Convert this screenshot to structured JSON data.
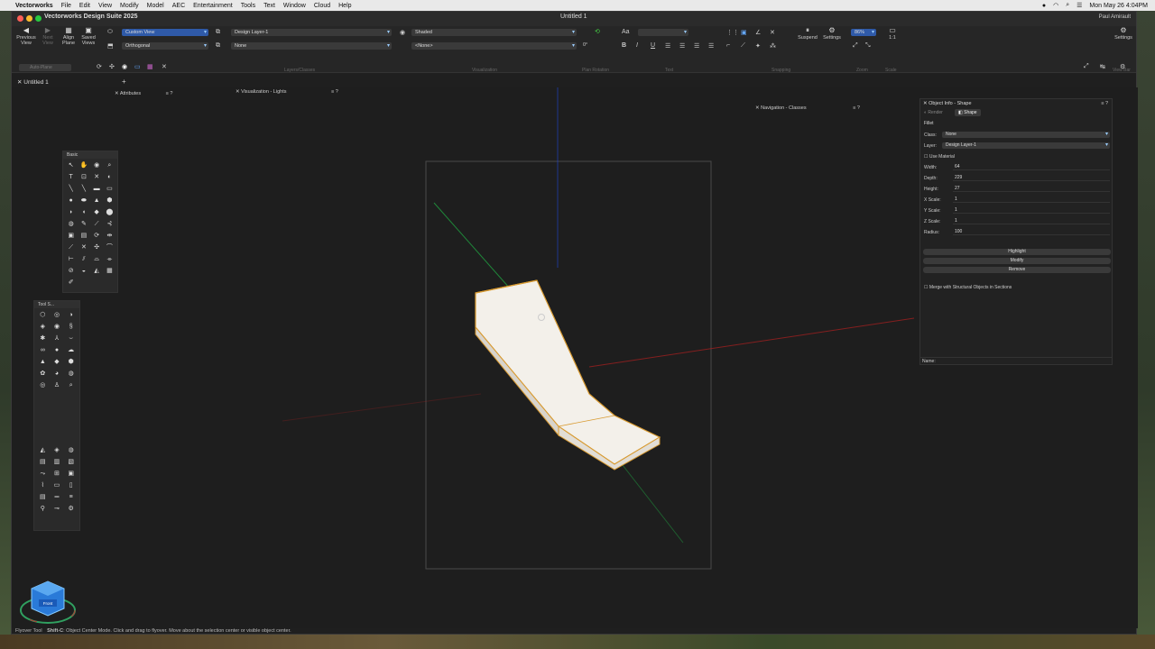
{
  "menubar": {
    "app": "Vectorworks",
    "items": [
      "File",
      "Edit",
      "View",
      "Modify",
      "Model",
      "AEC",
      "Entertainment",
      "Tools",
      "Text",
      "Window",
      "Cloud",
      "Help"
    ],
    "datetime": "Mon May 26 4:04PM"
  },
  "window": {
    "app_title": "Vectorworks Design Suite 2025",
    "doc_title": "Untitled 1",
    "user": "Paul Amirault"
  },
  "toolbar": {
    "previous_view": "Previous View",
    "next_view": "Next View",
    "align_plane": "Align Plane",
    "saved_views": "Saved Views",
    "view_select": "Custom View",
    "projection_select": "Orthogonal",
    "layer_select": "Design Layer-1",
    "class_select": "None",
    "render_select": "Shaded",
    "sheet_select": "<None>",
    "rotation_value": "0°",
    "suspend": "Suspend",
    "settings": "Settings",
    "zoom_value": "86%",
    "scale_value": "1:1",
    "settings_right": "Settings",
    "group_labels": {
      "view": "View",
      "layers_classes": "Layers/Classes",
      "visualization": "Visualization",
      "plan_rotation": "Plan Rotation",
      "text": "Text",
      "snapping": "Snapping",
      "zoom": "Zoom",
      "scale": "Scale",
      "view_bar": "View Bar"
    }
  },
  "modebar": {
    "mode": "Auto-Plane"
  },
  "tabs": {
    "doc_tab": "Untitled 1"
  },
  "panels": {
    "attributes": "Attributes",
    "vis_lights": "Visualization - Lights",
    "nav_classes": "Navigation - Classes",
    "basic": "Basic",
    "tool_sets": "Tool S..."
  },
  "oip": {
    "title": "Object Info - Shape",
    "tab_render": "Render",
    "tab_shape": "Shape",
    "object_type": "Fillet",
    "class_label": "Class:",
    "class_value": "None",
    "layer_label": "Layer:",
    "layer_value": "Design Layer-1",
    "use_material": "Use Material",
    "fields": [
      {
        "label": "Width:",
        "value": "64"
      },
      {
        "label": "Depth:",
        "value": "229"
      },
      {
        "label": "Height:",
        "value": "27"
      },
      {
        "label": "X Scale:",
        "value": "1"
      },
      {
        "label": "Y Scale:",
        "value": "1"
      },
      {
        "label": "Z Scale:",
        "value": "1"
      },
      {
        "label": "Radius:",
        "value": "100"
      }
    ],
    "highlight": "Highlight",
    "modify": "Modify",
    "remove": "Remove",
    "merge": "Merge with Structural Objects in Sections",
    "name_label": "Name:"
  },
  "status": {
    "tool": "Flyover Tool",
    "shortcut": "Shift-C",
    "hint": ": Object Center Mode. Click and drag to flyover.  Move about the selection center or visible object center."
  },
  "cube": {
    "label": "Front"
  },
  "colors": {
    "accent": "#2f5aa8",
    "selection": "#d89a30",
    "x_axis": "#b02020",
    "y_axis": "#20a040",
    "z_axis": "#2040c0"
  }
}
